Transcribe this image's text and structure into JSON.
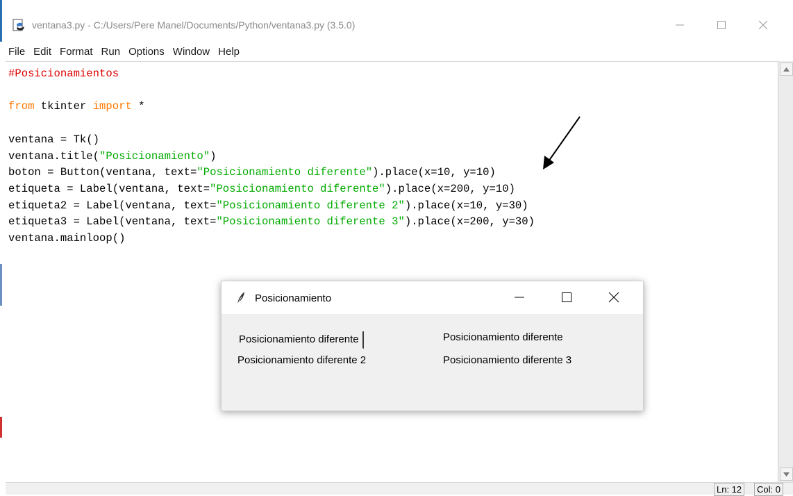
{
  "window": {
    "title": "ventana3.py - C:/Users/Pere Manel/Documents/Python/ventana3.py (3.5.0)"
  },
  "menu": [
    "File",
    "Edit",
    "Format",
    "Run",
    "Options",
    "Window",
    "Help"
  ],
  "status": {
    "line": "Ln: 12",
    "col": "Col: 0"
  },
  "popup": {
    "title": "Posicionamiento",
    "button_label": "Posicionamiento diferente",
    "label_1": "Posicionamiento diferente",
    "label_2": "Posicionamiento diferente 2",
    "label_3": "Posicionamiento diferente 3"
  },
  "colors": {
    "comment": "#dd0000",
    "keyword": "#ff7700",
    "string": "#00aa00"
  },
  "code_lines": [
    [
      {
        "t": "comment",
        "v": "#Posicionamientos"
      }
    ],
    [],
    [
      {
        "t": "kw",
        "v": "from"
      },
      {
        "t": "plain",
        "v": " tkinter "
      },
      {
        "t": "kw",
        "v": "import"
      },
      {
        "t": "plain",
        "v": " *"
      }
    ],
    [],
    [
      {
        "t": "plain",
        "v": "ventana = Tk()"
      }
    ],
    [
      {
        "t": "plain",
        "v": "ventana.title("
      },
      {
        "t": "str",
        "v": "\"Posicionamiento\""
      },
      {
        "t": "plain",
        "v": ")"
      }
    ],
    [
      {
        "t": "plain",
        "v": "boton = Button(ventana, text="
      },
      {
        "t": "str",
        "v": "\"Posicionamiento diferente\""
      },
      {
        "t": "plain",
        "v": ").place(x=10, y=10)"
      }
    ],
    [
      {
        "t": "plain",
        "v": "etiqueta = Label(ventana, text="
      },
      {
        "t": "str",
        "v": "\"Posicionamiento diferente\""
      },
      {
        "t": "plain",
        "v": ").place(x=200, y=10)"
      }
    ],
    [
      {
        "t": "plain",
        "v": "etiqueta2 = Label(ventana, text="
      },
      {
        "t": "str",
        "v": "\"Posicionamiento diferente 2\""
      },
      {
        "t": "plain",
        "v": ").place(x=10, y=30)"
      }
    ],
    [
      {
        "t": "plain",
        "v": "etiqueta3 = Label(ventana, text="
      },
      {
        "t": "str",
        "v": "\"Posicionamiento diferente 3\""
      },
      {
        "t": "plain",
        "v": ").place(x=200, y=30)"
      }
    ],
    [
      {
        "t": "plain",
        "v": "ventana.mainloop()"
      }
    ]
  ]
}
